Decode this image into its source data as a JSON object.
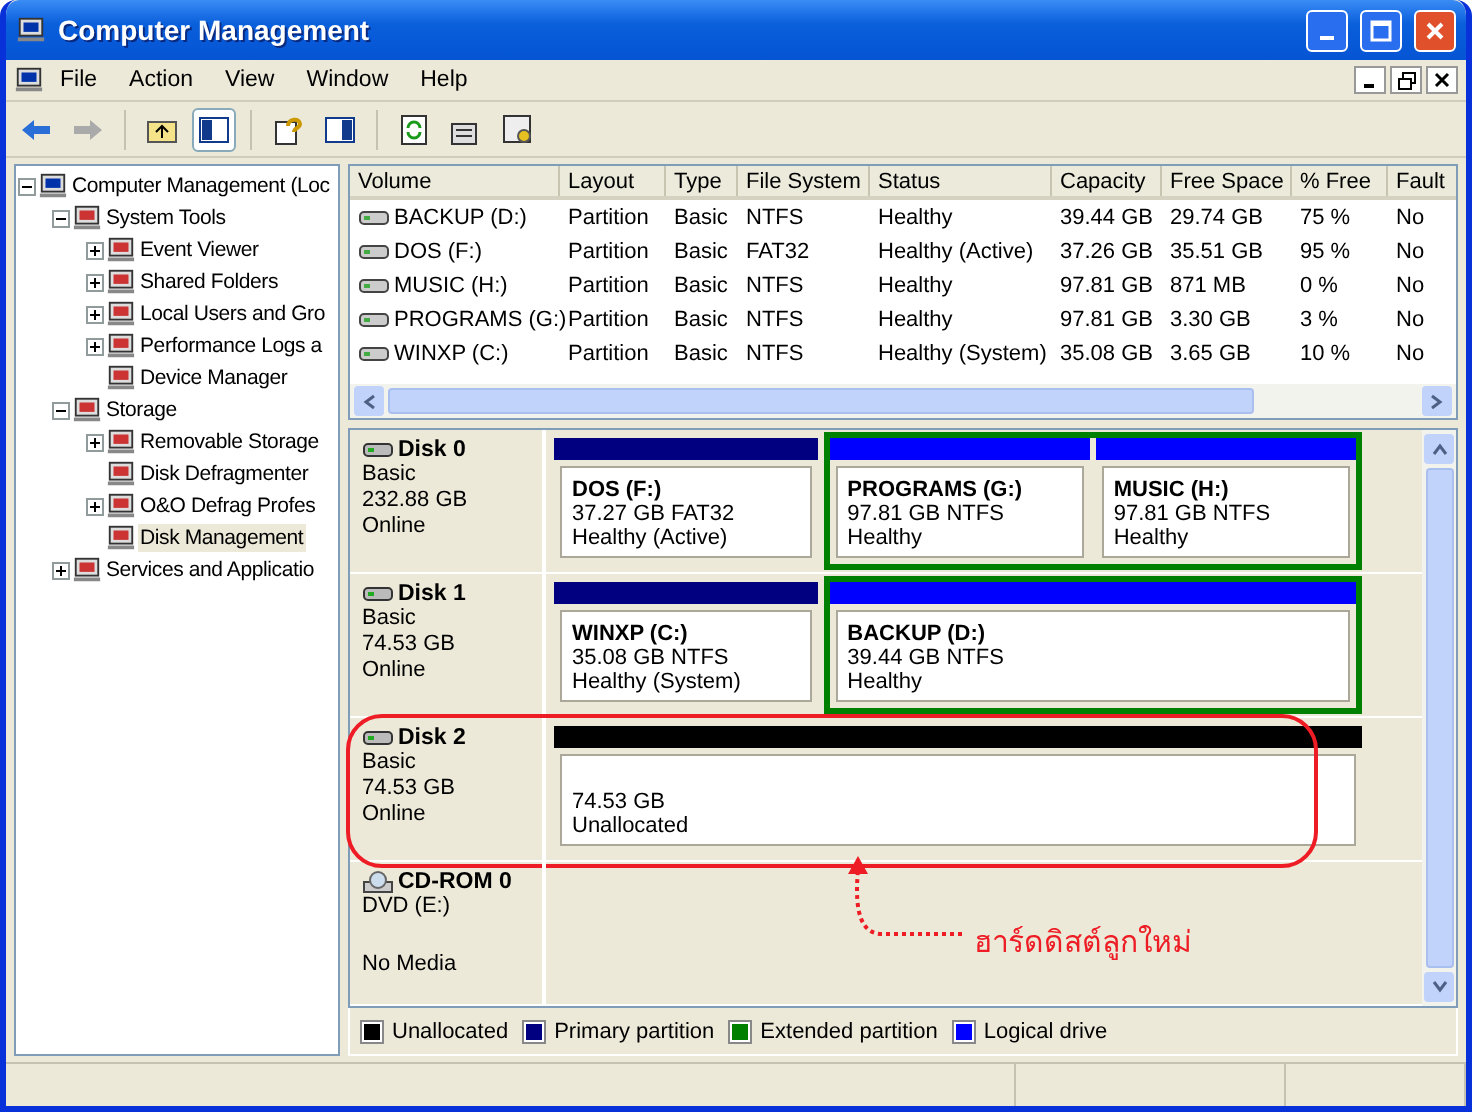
{
  "window": {
    "title": "Computer Management"
  },
  "menu": [
    "File",
    "Action",
    "View",
    "Window",
    "Help"
  ],
  "tree": [
    {
      "label": "Computer Management (Loc",
      "expanded": true,
      "selected": false,
      "children": [
        {
          "label": "System Tools",
          "expanded": true,
          "selected": false,
          "children": [
            {
              "label": "Event Viewer",
              "expanded": false,
              "selected": false
            },
            {
              "label": "Shared Folders",
              "expanded": false,
              "selected": false
            },
            {
              "label": "Local Users and Gro",
              "expanded": false,
              "selected": false
            },
            {
              "label": "Performance Logs a",
              "expanded": false,
              "selected": false
            },
            {
              "label": "Device Manager",
              "selected": false
            }
          ]
        },
        {
          "label": "Storage",
          "expanded": true,
          "selected": false,
          "children": [
            {
              "label": "Removable Storage",
              "expanded": false,
              "selected": false
            },
            {
              "label": "Disk Defragmenter",
              "selected": false
            },
            {
              "label": "O&O Defrag Profes",
              "expanded": false,
              "selected": false
            },
            {
              "label": "Disk Management",
              "selected": true
            }
          ]
        },
        {
          "label": "Services and Applicatio",
          "expanded": false,
          "selected": false
        }
      ]
    }
  ],
  "volumes": {
    "columns": [
      "Volume",
      "Layout",
      "Type",
      "File System",
      "Status",
      "Capacity",
      "Free Space",
      "% Free",
      "Fault"
    ],
    "rows": [
      [
        "BACKUP (D:)",
        "Partition",
        "Basic",
        "NTFS",
        "Healthy",
        "39.44 GB",
        "29.74 GB",
        "75 %",
        "No"
      ],
      [
        "DOS (F:)",
        "Partition",
        "Basic",
        "FAT32",
        "Healthy (Active)",
        "37.26 GB",
        "35.51 GB",
        "95 %",
        "No"
      ],
      [
        "MUSIC (H:)",
        "Partition",
        "Basic",
        "NTFS",
        "Healthy",
        "97.81 GB",
        "871 MB",
        "0 %",
        "No"
      ],
      [
        "PROGRAMS (G:)",
        "Partition",
        "Basic",
        "NTFS",
        "Healthy",
        "97.81 GB",
        "3.30 GB",
        "3 %",
        "No"
      ],
      [
        "WINXP (C:)",
        "Partition",
        "Basic",
        "NTFS",
        "Healthy (System)",
        "35.08 GB",
        "3.65 GB",
        "10 %",
        "No"
      ]
    ]
  },
  "disks": [
    {
      "kind": "disk",
      "name": "Disk 0",
      "lines": [
        "Basic",
        "232.88 GB",
        "Online"
      ],
      "circled": false,
      "partitions": [
        {
          "kind": "primary",
          "name": "DOS  (F:)",
          "size": "37.27 GB FAT32",
          "status": "Healthy (Active)"
        },
        {
          "kind": "extended",
          "children": [
            {
              "kind": "logical",
              "name": "PROGRAMS  (G:)",
              "size": "97.81 GB NTFS",
              "status": "Healthy"
            },
            {
              "kind": "logical",
              "name": "MUSIC  (H:)",
              "size": "97.81 GB NTFS",
              "status": "Healthy"
            }
          ]
        }
      ]
    },
    {
      "kind": "disk",
      "name": "Disk 1",
      "lines": [
        "Basic",
        "74.53 GB",
        "Online"
      ],
      "circled": false,
      "partitions": [
        {
          "kind": "primary",
          "name": "WINXP  (C:)",
          "size": "35.08 GB NTFS",
          "status": "Healthy (System)"
        },
        {
          "kind": "extended",
          "children": [
            {
              "kind": "logical",
              "name": "BACKUP  (D:)",
              "size": "39.44 GB NTFS",
              "status": "Healthy"
            }
          ]
        }
      ]
    },
    {
      "kind": "disk",
      "name": "Disk 2",
      "lines": [
        "Basic",
        "74.53 GB",
        "Online"
      ],
      "circled": true,
      "partitions": [
        {
          "kind": "unallocated",
          "size": "74.53 GB",
          "status": "Unallocated"
        }
      ]
    },
    {
      "kind": "cdrom",
      "name": "CD-ROM 0",
      "lines": [
        "DVD (E:)",
        "No Media"
      ],
      "circled": false
    }
  ],
  "annotation": {
    "text": "ฮาร์ดดิสต์ลูกใหม่"
  },
  "legend": [
    {
      "label": "Unallocated",
      "color": "#000000"
    },
    {
      "label": "Primary partition",
      "color": "#000080"
    },
    {
      "label": "Extended partition",
      "color": "#008000"
    },
    {
      "label": "Logical drive",
      "color": "#0000ff"
    }
  ]
}
